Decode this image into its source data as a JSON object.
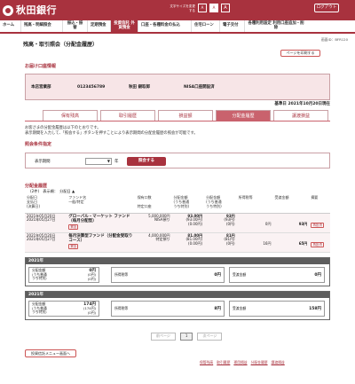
{
  "brand": {
    "name": "秋田銀行"
  },
  "header": {
    "fontsize_label": "文字サイズを変更する",
    "fontsize_small": "A",
    "fontsize_mid": "A",
    "fontsize_large": "A",
    "logout": "ログアウト"
  },
  "gnav": [
    "ホーム",
    "残高・明細照会",
    "振込・振替",
    "定期預金",
    "投資信託 外貨預金",
    "口座・各種料金の払込",
    "住宅ローン",
    "電子交付",
    "各種利用設定 利用口座追加・削除"
  ],
  "subnav": "画面ID：BFR120",
  "page": {
    "title": "残高・取引照会（分配金履歴）",
    "print_button": "ページを印刷する"
  },
  "account": {
    "section_title": "お届け口座情報",
    "branch": "本店営業部",
    "number": "0123456789",
    "holder": "秋田 銀取郎",
    "nisa": "NISA口座開設済"
  },
  "base_date": "基準日 2021年10月20日現在",
  "tabs": [
    "保有残高",
    "取引履歴",
    "損益額",
    "分配金履歴",
    "譲渡損益"
  ],
  "notes": {
    "line1": "お客さまの分配金履歴は以下のとおりです。",
    "line2": "表示期間を入力して、「照会する」ボタンを押すことにより表示期間の分配金履歴の照会が可能です。"
  },
  "query": {
    "section_title": "照会条件指定",
    "label": "表示期間",
    "year_value": "",
    "year_unit": "年",
    "submit": "照会する"
  },
  "history": {
    "section_title": "分配金履歴",
    "condition": "(2件)　表示順：　分配日 ▲",
    "headers": {
      "c1": "分配日\n支払日\n(決算日)",
      "c2": "ファンド名\n一般/特定",
      "c3": "保有口数\n\n特定口座",
      "c4": "分配金額\n(うち普通\nうち特別)",
      "c5": "分配金額\n(うち普通\nうち特別)",
      "c6": "所得税等",
      "c7": "受渡金額",
      "c8": "摘要"
    },
    "rows": [
      {
        "date": "2021年05月20日\n2021年05月27日",
        "fund": "グローバル・マーケット ファンド（毎月分配型）",
        "badge": "累投",
        "units": "5,000,000円",
        "units_type": "NISA預り",
        "dist1": "93.00円",
        "dist1b": "(93.00円)",
        "dist1c": "(0.00円)",
        "dist2": "93円",
        "dist2b": "(93円)",
        "dist2c": "(0円)",
        "tax": "0円",
        "amount": "93円",
        "note": "再投資"
      },
      {
        "date": "2021年05月20日\n2021年05月27日",
        "fund": "毎月決算型ファンド（分配金受取りコース）",
        "badge": "累投",
        "units": "4,000,000円",
        "units_type": "特定預り",
        "dist1": "81.00円",
        "dist1b": "(81.00円)",
        "dist1c": "(0.00円)",
        "dist2": "81円",
        "dist2b": "(81円)",
        "dist2c": "(0円)",
        "tax": "16円",
        "amount": "65円",
        "note": "再投資"
      }
    ]
  },
  "year_summaries": [
    {
      "year": "2021年",
      "dist_label": "分配金額\n(うち普通\nうち特別)",
      "dist": "0円",
      "dist_b": "(0円)",
      "dist_c": "(0円)",
      "tax_label": "所得税等",
      "tax": "0円",
      "amt_label": "受渡金額",
      "amt": "0円"
    },
    {
      "year": "2021年",
      "dist_label": "分配金額\n(うち普通\nうち特別)",
      "dist": "174円",
      "dist_b": "(174円)",
      "dist_c": "(0円)",
      "tax_label": "所得税等",
      "tax": "8円",
      "amt_label": "受渡金額",
      "amt": "158円"
    }
  ],
  "pager": {
    "prev": "前ページ",
    "current": "1",
    "next": "次ページ"
  },
  "back_button": "投資信託メニュー画面へ",
  "footer_nav": [
    "保管残高",
    "取引履歴",
    "運用損益",
    "分配金履歴",
    "譲渡損益"
  ]
}
